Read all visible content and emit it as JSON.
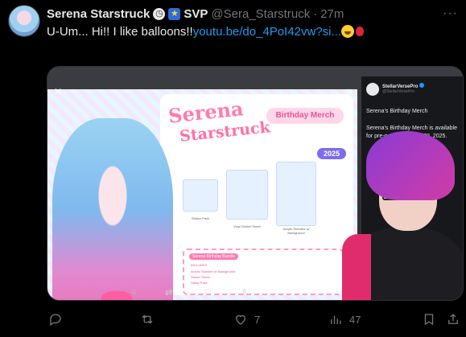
{
  "post": {
    "display_name": "Serena Starstruck",
    "badges": [
      "clock-badge",
      "star-badge"
    ],
    "tag": "SVP",
    "handle": "@Sera_Starstruck",
    "separator": "·",
    "time": "27m",
    "text_prefix": "U-Um... Hi!! I like balloons!!",
    "link": "youtu.be/do_4PoI42vw?si...",
    "emoji": [
      "smiling-face",
      "balloon"
    ]
  },
  "media": {
    "merch": {
      "title_line1": "Serena",
      "title_line2": "Starstruck",
      "badge": "Birthday Merch",
      "year": "2025",
      "items": [
        "Sticker Pack",
        "Vinyl Sticker Sheet",
        "Acrylic Standee w/ Background"
      ],
      "bundle_title": "Serena Birthday Bundle",
      "bundle_includes_label": "INCLUDES",
      "bundle_items": [
        "Acrylic Standee w/ Background",
        "Sticker Sheet",
        "Sticky Pack"
      ]
    },
    "embedded_post": {
      "name": "StellarVersePro",
      "handle": "@StellarVersePro",
      "headline": "Serena's Birthday Merch",
      "body": "Serena's Birthday Merch is available for pre-order until April 28, 2025."
    }
  },
  "actions": {
    "reply_count": "",
    "repost_count": "",
    "like_count": "7",
    "views_count": "47"
  },
  "colors": {
    "background": "#000000",
    "link": "#1d9bf0",
    "muted": "#71767b",
    "text": "#e7e9ea"
  }
}
